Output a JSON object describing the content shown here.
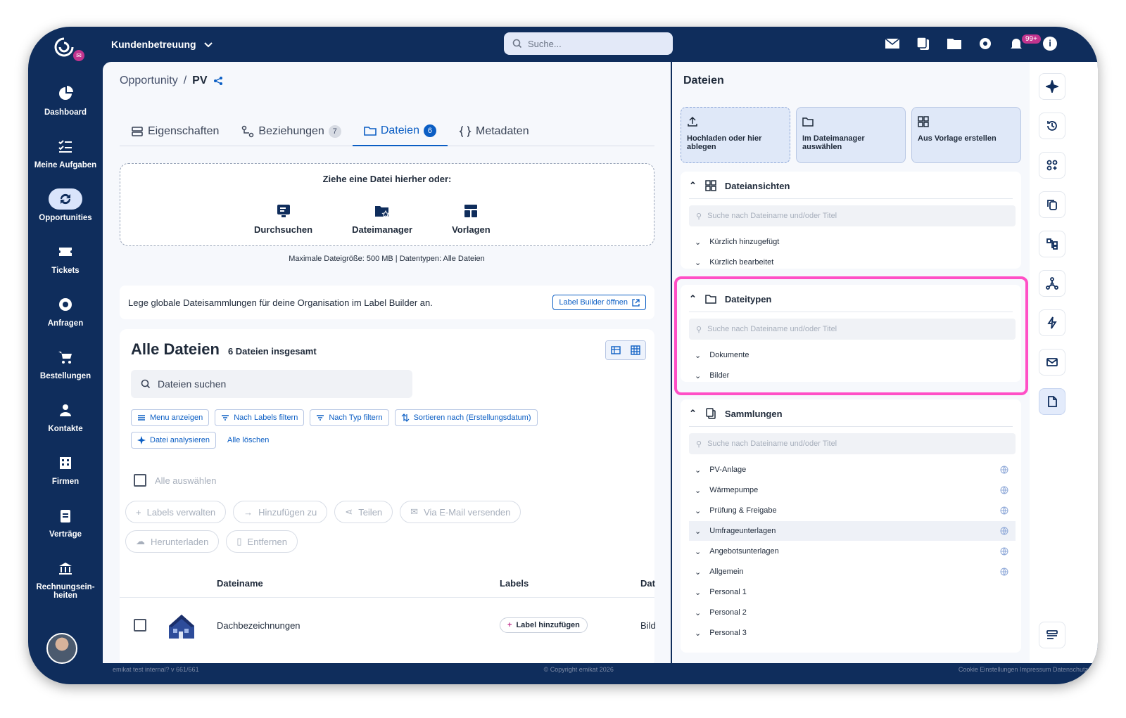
{
  "topbar": {
    "workspace": "Kundenbetreuung",
    "search_placeholder": "Suche...",
    "notif_count": "99+",
    "info": "i",
    "logo_badge": "✉"
  },
  "sidebar": {
    "items": [
      {
        "label": "Dashboard",
        "icon": "pie-chart-icon"
      },
      {
        "label": "Meine Aufgaben",
        "icon": "task-list-icon"
      },
      {
        "label": "Opportunities",
        "icon": "refresh-cycle-icon"
      },
      {
        "label": "Tickets",
        "icon": "ticket-icon"
      },
      {
        "label": "Anfragen",
        "icon": "lifebuoy-icon"
      },
      {
        "label": "Bestellungen",
        "icon": "cart-icon"
      },
      {
        "label": "Kontakte",
        "icon": "person-icon"
      },
      {
        "label": "Firmen",
        "icon": "building-icon"
      },
      {
        "label": "Verträge",
        "icon": "clipboard-icon"
      },
      {
        "label": "Rechnungsein-heiten",
        "icon": "bank-icon"
      }
    ]
  },
  "breadcrumb": {
    "parent": "Opportunity",
    "sep": "/",
    "current": "PV"
  },
  "tabs": [
    {
      "label": "Eigenschaften",
      "count": ""
    },
    {
      "label": "Beziehungen",
      "count": "7"
    },
    {
      "label": "Dateien",
      "count": "6"
    },
    {
      "label": "Metadaten",
      "count": ""
    }
  ],
  "dropzone": {
    "title": "Ziehe eine Datei hierher oder:",
    "options": [
      "Durchsuchen",
      "Dateimanager",
      "Vorlagen"
    ],
    "limits": "Maximale Dateigröße: 500 MB  |  Datentypen: Alle Dateien"
  },
  "banner": {
    "text": "Lege globale Dateisammlungen für deine Organisation im Label Builder an.",
    "button": "Label Builder öffnen"
  },
  "files": {
    "title": "Alle Dateien",
    "count": "6 Dateien insgesamt",
    "search_placeholder": "Dateien suchen",
    "filters": [
      "Menu anzeigen",
      "Nach Labels filtern",
      "Nach Typ filtern",
      "Sortieren nach (Erstellungsdatum)",
      "Datei analysieren",
      "Alle löschen"
    ],
    "select_all": "Alle auswählen",
    "actions": [
      "Labels verwalten",
      "Hinzufügen zu",
      "Teilen",
      "Via E-Mail versenden",
      "Herunterladen",
      "Entfernen"
    ],
    "columns": [
      "Dateiname",
      "Labels",
      "Dat"
    ],
    "rows": [
      {
        "name": "Dachbezeichnungen",
        "label_btn": "Label hinzufügen",
        "type": "Bild"
      }
    ]
  },
  "footer": {
    "left": "emikat test internal? v 661/661",
    "center": "© Copyright emikat 2026",
    "right": "Cookie Einstellungen  Impressum  Datenschutz"
  },
  "rpanel": {
    "title": "Dateien",
    "upload_cards": [
      "Hochladen oder hier ablegen",
      "Im Dateimanager auswählen",
      "Aus Vorlage erstellen"
    ],
    "search_placeholder": "Suche nach Dateiname und/oder Titel",
    "sections": [
      {
        "title": "Dateiansichten",
        "items": [
          "Kürzlich hinzugefügt",
          "Kürzlich bearbeitet"
        ]
      },
      {
        "title": "Dateitypen",
        "items": [
          "Dokumente",
          "Bilder"
        ]
      },
      {
        "title": "Sammlungen",
        "items": [
          "PV-Anlage",
          "Wärmepumpe",
          "Prüfung & Freigabe",
          "Umfrageunterlagen",
          "Angebotsunterlagen",
          "Allgemein",
          "Personal 1",
          "Personal 2",
          "Personal 3"
        ]
      }
    ]
  },
  "rrail": [
    "sparkle-icon",
    "history-icon",
    "grid-icon",
    "copy-icon",
    "hierarchy-icon",
    "network-icon",
    "lightning-icon",
    "mail-icon",
    "file-icon",
    "list-settings-icon"
  ],
  "colors": {
    "navy": "#0f2d5c",
    "accent": "#0b5ec4",
    "badge": "#c2348e",
    "highlight": "#ff4fc6"
  }
}
